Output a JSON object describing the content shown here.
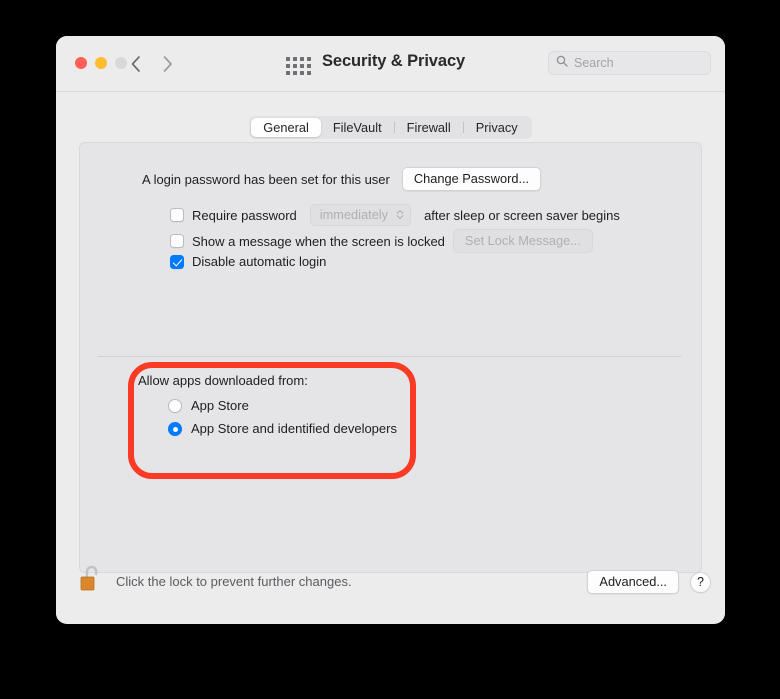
{
  "window": {
    "title": "Security & Privacy",
    "traffic_lights": [
      "close-button",
      "minimize-button",
      "zoom-button"
    ],
    "back_icon": "chevron-left-icon",
    "forward_icon": "chevron-right-icon",
    "grid_icon": "show-all-grid-icon"
  },
  "search": {
    "placeholder": "Search",
    "value": "",
    "icon": "search-icon"
  },
  "tabs": [
    {
      "label": "General",
      "active": true
    },
    {
      "label": "FileVault",
      "active": false
    },
    {
      "label": "Firewall",
      "active": false
    },
    {
      "label": "Privacy",
      "active": false
    }
  ],
  "general": {
    "password_status": "A login password has been set for this user",
    "change_password_label": "Change Password...",
    "require_password": {
      "checked": false,
      "label_before": "Require password",
      "interval": "immediately",
      "label_after": "after sleep or screen saver begins",
      "stepper_icon": "chevron-up-down-icon",
      "disabled": true
    },
    "show_message": {
      "checked": false,
      "label": "Show a message when the screen is locked",
      "button_label": "Set Lock Message...",
      "button_disabled": true
    },
    "disable_auto_login": {
      "checked": true,
      "label": "Disable automatic login"
    },
    "allow_apps": {
      "title": "Allow apps downloaded from:",
      "options": [
        {
          "label": "App Store",
          "selected": false
        },
        {
          "label": "App Store and identified developers",
          "selected": true
        }
      ]
    }
  },
  "footer": {
    "lock_icon": "unlocked-padlock-icon",
    "lock_text": "Click the lock to prevent further changes.",
    "advanced_label": "Advanced...",
    "help_label": "?"
  },
  "annotation": {
    "shape": "rounded-rectangle-highlight",
    "color": "#f93a24"
  },
  "colors": {
    "accent": "#007aff",
    "window_bg": "#ececed",
    "panel_bg": "#e5e5e7",
    "annotation": "#f93a24"
  }
}
